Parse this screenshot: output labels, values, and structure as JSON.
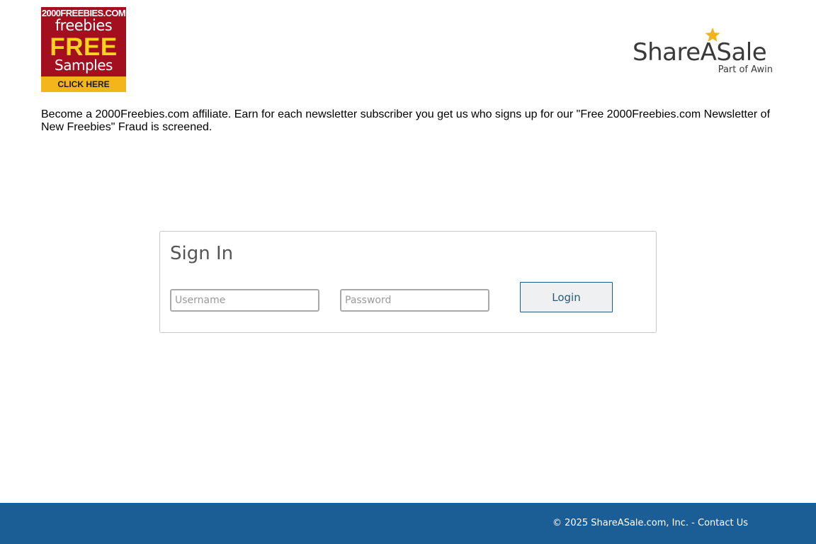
{
  "banner": {
    "site": "2000FREEBIES.COM",
    "line1": "freebies",
    "line2": "FREE",
    "line3": "Samples",
    "cta": "CLICK HERE",
    "colors": {
      "background": "#a30f1f",
      "accent": "#ffd21f",
      "cta": "#f4b51a"
    }
  },
  "logo": {
    "name": "ShareASale",
    "sub": "Part of Awin",
    "icon": "star-icon",
    "star_color": "#f3b41b"
  },
  "description": "Become a 2000Freebies.com affiliate. Earn for each newsletter subscriber you get us who signs up for our \"Free 2000Freebies.com Newsletter of New Freebies\" Fraud is screened.",
  "signin": {
    "title": "Sign In",
    "username_placeholder": "Username",
    "password_placeholder": "Password",
    "username_value": "",
    "password_value": "",
    "login_label": "Login"
  },
  "footer": {
    "copyright": "© 2025 ShareASale.com, Inc. - ",
    "contact_label": "Contact Us",
    "background": "#1b5e96"
  }
}
